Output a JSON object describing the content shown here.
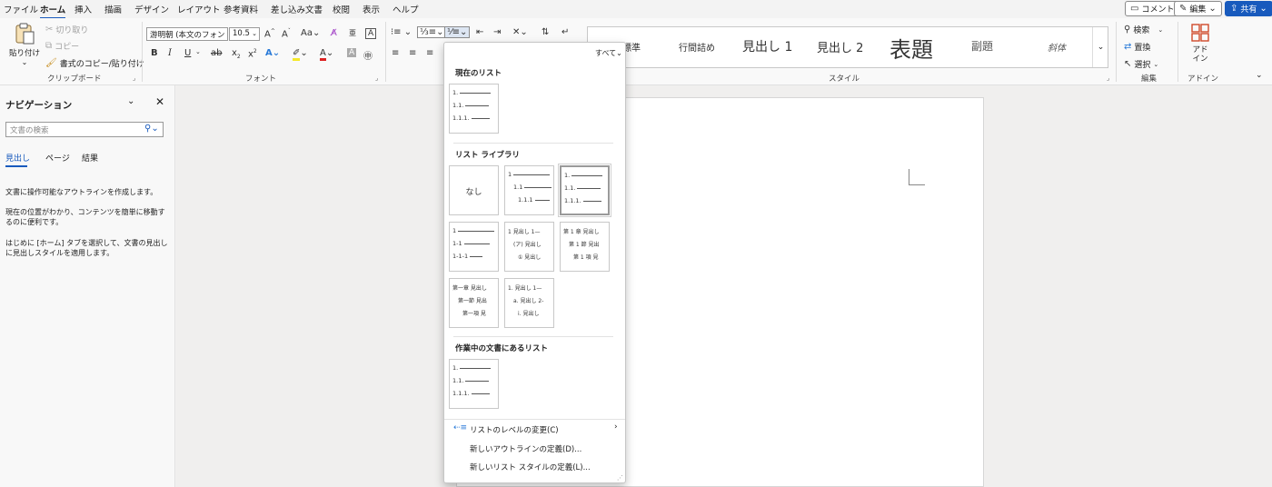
{
  "menu": {
    "tabs": [
      "ファイル",
      "ホーム",
      "挿入",
      "描画",
      "デザイン",
      "レイアウト",
      "参考資料",
      "差し込み文書",
      "校閲",
      "表示",
      "ヘルプ"
    ],
    "active": "ホーム",
    "comment_label": "コメント",
    "edit_label": "編集",
    "share_label": "共有"
  },
  "clipboard": {
    "paste": "貼り付け",
    "cut": "切り取り",
    "copy": "コピー",
    "format_painter": "書式のコピー/貼り付け",
    "group": "クリップボード"
  },
  "font": {
    "name": "游明朝 (本文のフォン",
    "size": "10.5",
    "group": "フォント"
  },
  "styles": {
    "items": [
      "行間詰め",
      "見出し 1",
      "見出し 2",
      "表題",
      "副題",
      "斜体"
    ],
    "partial_first": "標準",
    "group": "スタイル"
  },
  "editing": {
    "find": "検索",
    "replace": "置換",
    "select": "選択",
    "group": "編集"
  },
  "addins": {
    "label": "アド イン",
    "group": "アドイン"
  },
  "nav": {
    "title": "ナビゲーション",
    "search_placeholder": "文書の検索",
    "tabs": [
      "見出し",
      "ページ",
      "結果"
    ],
    "help1": "文書に操作可能なアウトラインを作成します。",
    "help2": "現在の位置がわかり、コンテンツを簡単に移動するのに便利です。",
    "help3": "はじめに [ホーム] タブを選択して、文書の見出しに見出しスタイルを適用します。"
  },
  "dropdown": {
    "filter": "すべて",
    "section_current": "現在のリスト",
    "section_library": "リスト ライブラリ",
    "section_document": "作業中の文書にあるリスト",
    "none_label": "なし",
    "change_level": "リストのレベルの変更(C)",
    "define_outline": "新しいアウトラインの定義(D)...",
    "define_style": "新しいリスト スタイルの定義(L)..."
  },
  "list_tiles": {
    "t_num": [
      "1.",
      "1.1.",
      "1.1.1."
    ],
    "t_plain": [
      "1",
      "1.1",
      "1.1.1"
    ],
    "t_dash": [
      "1",
      "1-1",
      "1-1-1"
    ],
    "t_heading": [
      "1 見出し 1—",
      "(ア) 見出し",
      "① 見出し"
    ],
    "t_chapter": [
      "第 1 章 見出し",
      "第 1 節 見出",
      "第 1 項 見"
    ],
    "t_kanji": [
      "第一章 見出し",
      "第一節 見出",
      "第一項 見"
    ],
    "t_alpha": [
      "1. 見出し 1—",
      "a. 見出し 2-",
      "i. 見出し"
    ]
  },
  "colors": {
    "accent": "#185abd",
    "ribbon_bg": "#f9f9f9",
    "page_bg": "#f0efee"
  }
}
